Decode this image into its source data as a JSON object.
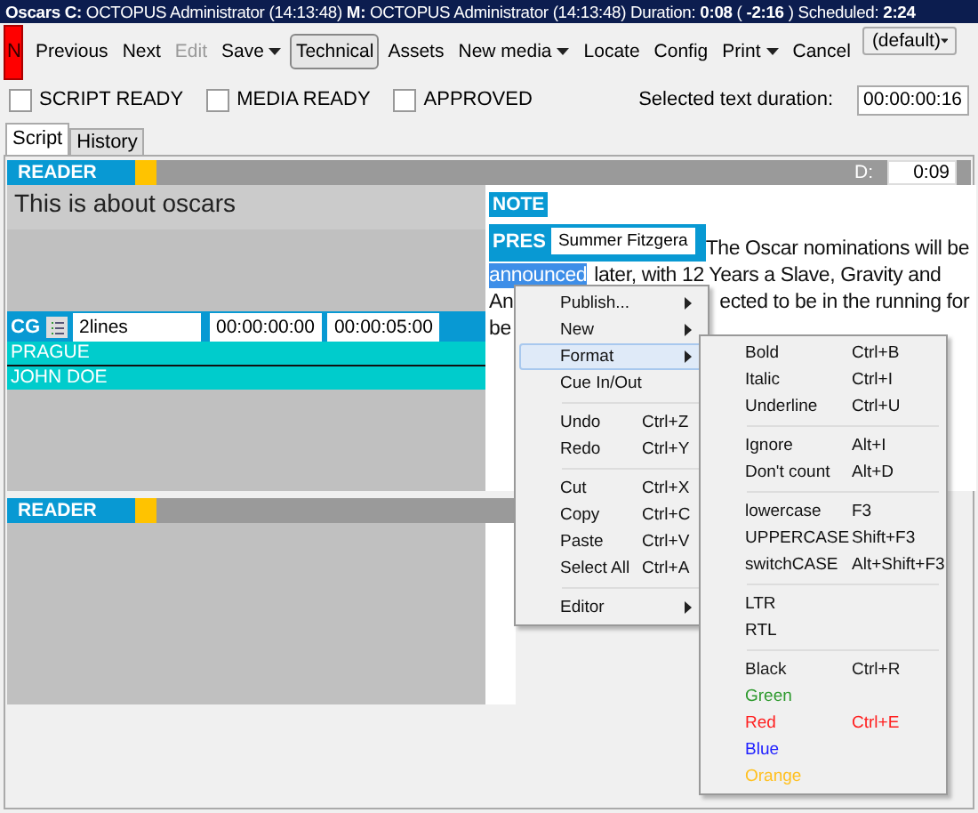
{
  "title_bar": {
    "text": "**Oscars** **C:** OCTOPUS Administrator (14:13:48) **M:** OCTOPUS Administrator (14:13:48) Duration: **0:08** ( **-2:16** ) Scheduled: **2:24**"
  },
  "status_badge": {
    "text": "N"
  },
  "toolbar": [
    {
      "label": "Previous",
      "disabled": false,
      "pressed": false,
      "dropdown": false
    },
    {
      "label": "Next",
      "disabled": false,
      "pressed": false,
      "dropdown": false
    },
    {
      "label": "Edit",
      "disabled": true,
      "pressed": false,
      "dropdown": false
    },
    {
      "label": "Save",
      "disabled": false,
      "pressed": false,
      "dropdown": true
    },
    {
      "label": "Technical",
      "disabled": false,
      "pressed": true,
      "dropdown": false
    },
    {
      "label": "Assets",
      "disabled": false,
      "pressed": false,
      "dropdown": false
    },
    {
      "label": "New media",
      "disabled": false,
      "pressed": false,
      "dropdown": true
    },
    {
      "label": "Locate",
      "disabled": false,
      "pressed": false,
      "dropdown": false
    },
    {
      "label": "Config",
      "disabled": false,
      "pressed": false,
      "dropdown": false
    },
    {
      "label": "Print",
      "disabled": false,
      "pressed": false,
      "dropdown": true
    },
    {
      "label": "Cancel",
      "disabled": false,
      "pressed": false,
      "dropdown": false
    }
  ],
  "profile_dropdown": {
    "value": "(default)"
  },
  "checkboxes": [
    {
      "label": "SCRIPT READY",
      "checked": false
    },
    {
      "label": "MEDIA READY",
      "checked": false
    },
    {
      "label": "APPROVED",
      "checked": false
    }
  ],
  "selected_text_duration": {
    "label": "Selected text duration:",
    "value": "00:00:00:16"
  },
  "tabs": [
    {
      "label": "Script",
      "selected": true
    },
    {
      "label": "History",
      "selected": false
    }
  ],
  "reader": {
    "label": "READER",
    "duration_label": "D:",
    "duration": "0:09",
    "text": "This is about oscars",
    "cg": {
      "label": "CG",
      "template": "2lines",
      "time_in": "00:00:00:00",
      "time_out": "00:00:05:00",
      "lines": [
        "PRAGUE",
        "JOHN DOE"
      ]
    },
    "note": {
      "label": "NOTE"
    },
    "pres": {
      "label": "PRES",
      "value": "Summer Fitzgera"
    },
    "story_lines": [
      [
        {
          "text": "The Oscar nominations will be",
          "selected": false
        }
      ],
      [
        {
          "text": "announced",
          "selected": true
        },
        {
          "text": "later, with 12 Years a Slave, Gravity and",
          "selected": false
        }
      ],
      [
        {
          "text": "An",
          "selected": false
        },
        {
          "text": "ected to be in the running for",
          "selected": false
        }
      ],
      [
        {
          "text": "be",
          "selected": false
        }
      ]
    ]
  },
  "reader_2": {
    "label": "READER"
  },
  "context_menu": {
    "items": [
      {
        "kind": "item",
        "label": "Publish...",
        "submenu": true,
        "selected": false
      },
      {
        "kind": "item",
        "label": "New",
        "submenu": true,
        "selected": false
      },
      {
        "kind": "item",
        "label": "Format",
        "submenu": true,
        "selected": true
      },
      {
        "kind": "item",
        "label": "Cue In/Out",
        "submenu": false,
        "selected": false
      },
      {
        "kind": "separator"
      },
      {
        "kind": "item",
        "label": "Undo",
        "shortcut": "Ctrl+Z",
        "submenu": false,
        "selected": false
      },
      {
        "kind": "item",
        "label": "Redo",
        "shortcut": "Ctrl+Y",
        "submenu": false,
        "selected": false
      },
      {
        "kind": "separator"
      },
      {
        "kind": "item",
        "label": "Cut",
        "shortcut": "Ctrl+X",
        "submenu": false,
        "selected": false
      },
      {
        "kind": "item",
        "label": "Copy",
        "shortcut": "Ctrl+C",
        "submenu": false,
        "selected": false
      },
      {
        "kind": "item",
        "label": "Paste",
        "shortcut": "Ctrl+V",
        "submenu": false,
        "selected": false
      },
      {
        "kind": "item",
        "label": "Select All",
        "shortcut": "Ctrl+A",
        "submenu": false,
        "selected": false
      },
      {
        "kind": "separator"
      },
      {
        "kind": "item",
        "label": "Editor",
        "submenu": true,
        "selected": false
      }
    ]
  },
  "format_submenu": {
    "items": [
      {
        "kind": "item",
        "label": "Bold",
        "shortcut": "Ctrl+B"
      },
      {
        "kind": "item",
        "label": "Italic",
        "shortcut": "Ctrl+I"
      },
      {
        "kind": "item",
        "label": "Underline",
        "shortcut": "Ctrl+U"
      },
      {
        "kind": "separator"
      },
      {
        "kind": "item",
        "label": "Ignore",
        "shortcut": "Alt+I"
      },
      {
        "kind": "item",
        "label": "Don't count",
        "shortcut": "Alt+D"
      },
      {
        "kind": "separator"
      },
      {
        "kind": "item",
        "label": "lowercase",
        "shortcut": "F3"
      },
      {
        "kind": "item",
        "label": "UPPERCASE",
        "shortcut": "Shift+F3"
      },
      {
        "kind": "item",
        "label": "switchCASE",
        "shortcut": "Alt+Shift+F3"
      },
      {
        "kind": "separator"
      },
      {
        "kind": "item",
        "label": "LTR"
      },
      {
        "kind": "item",
        "label": "RTL"
      },
      {
        "kind": "separator"
      },
      {
        "kind": "item",
        "label": "Black",
        "shortcut": "Ctrl+R",
        "color": "#1a1a1a"
      },
      {
        "kind": "item",
        "label": "Green",
        "color": "#2e9a2e"
      },
      {
        "kind": "item",
        "label": "Red",
        "shortcut": "Ctrl+E",
        "color": "#ff2020"
      },
      {
        "kind": "item",
        "label": "Blue",
        "color": "#2020ff"
      },
      {
        "kind": "item",
        "label": "Orange",
        "color": "#ffc020"
      }
    ]
  }
}
